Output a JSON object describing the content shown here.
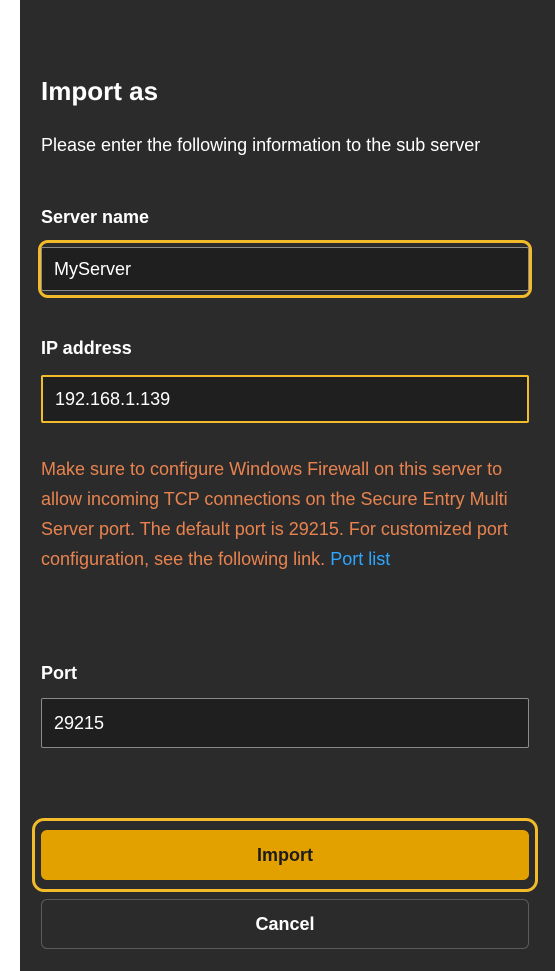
{
  "dialog": {
    "title": "Import as",
    "description": "Please enter the following information to the sub server",
    "server_name": {
      "label": "Server name",
      "value": "MyServer"
    },
    "ip_address": {
      "label": "IP address",
      "value": "192.168.1.139"
    },
    "warning": {
      "text": "Make sure to configure Windows Firewall on this server to allow incoming TCP connections on the Secure Entry Multi Server port. The default port is 29215. For customized port configuration, see the following link.",
      "link_label": "Port list"
    },
    "port": {
      "label": "Port",
      "value": "29215"
    },
    "buttons": {
      "import_label": "Import",
      "cancel_label": "Cancel"
    }
  },
  "colors": {
    "background": "#2b2b2b",
    "highlight": "#f3bb2a",
    "primary_button": "#e3a100",
    "warning_text": "#e8834f",
    "link": "#2ea6ff"
  }
}
